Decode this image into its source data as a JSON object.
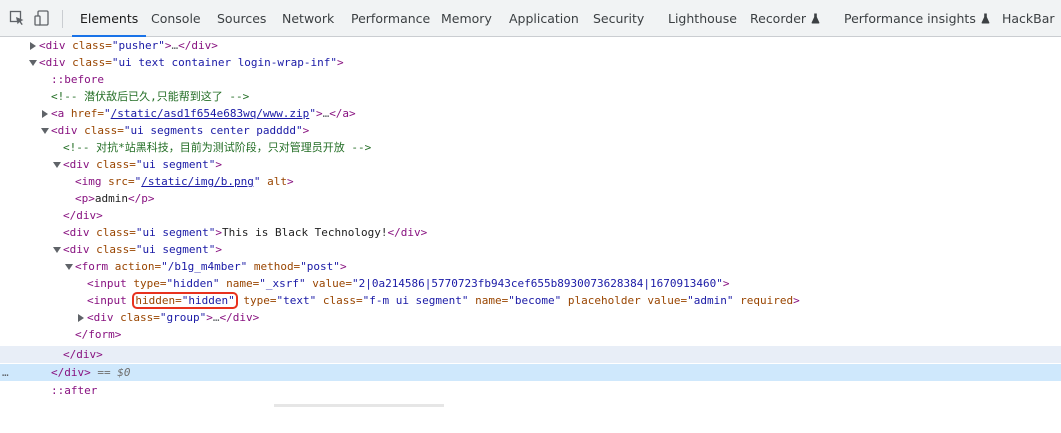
{
  "toolbar": {
    "inspect_icon": "select-element-icon",
    "device_icon": "device-toggle-icon",
    "tabs": [
      {
        "label": "Elements",
        "active": true
      },
      {
        "label": "Console"
      },
      {
        "label": "Sources"
      },
      {
        "label": "Network"
      },
      {
        "label": "Performance"
      },
      {
        "label": "Memory"
      },
      {
        "label": "Application"
      },
      {
        "label": "Security"
      },
      {
        "label": "Lighthouse"
      },
      {
        "label": "Recorder",
        "icon": "flask-icon"
      },
      {
        "label": "Performance insights",
        "icon": "flask-icon"
      },
      {
        "label": "HackBar"
      }
    ]
  },
  "tree": {
    "r0": {
      "open": "<div",
      "class_attr": " class=",
      "class_val": "\"pusher\"",
      "close": ">",
      "ellipsis": "…",
      "end": "</div>"
    },
    "r1": {
      "open": "<div",
      "class_attr": " class=",
      "class_val": "\"ui text container login-wrap-inf\"",
      "close": ">"
    },
    "r2": {
      "pseudo": "::before"
    },
    "r3": {
      "comment": "<!-- 潜伏敌后已久,只能帮到这了 -->"
    },
    "r4": {
      "open": "<a",
      "href_attr": " href=",
      "q1": "\"",
      "href_val": "/static/asd1f654e683wq/www.zip",
      "q2": "\"",
      "close": ">",
      "ellipsis": "…",
      "end": "</a>"
    },
    "r5": {
      "open": "<div",
      "class_attr": " class=",
      "class_val": "\"ui segments center padddd\"",
      "close": ">"
    },
    "r6": {
      "comment": "<!-- 对抗*站黑科技，目前为测试阶段，只对管理员开放 -->"
    },
    "r7": {
      "open": "<div",
      "class_attr": " class=",
      "class_val": "\"ui segment\"",
      "close": ">"
    },
    "r8": {
      "open": "<img",
      "src_attr": " src=",
      "q1": "\"",
      "src_val": "/static/img/b.png",
      "q2": "\"",
      "alt_attr": " alt",
      "close": ">"
    },
    "r9": {
      "open": "<p>",
      "text": "admin",
      "end": "</p>"
    },
    "r10": {
      "end": "</div>"
    },
    "r11": {
      "open": "<div",
      "class_attr": " class=",
      "class_val": "\"ui segment\"",
      "close": ">",
      "text": "This is Black Technology!",
      "end": "</div>"
    },
    "r12": {
      "open": "<div",
      "class_attr": " class=",
      "class_val": "\"ui segment\"",
      "close": ">"
    },
    "r13": {
      "open": "<form",
      "action_attr": " action=",
      "action_val": "\"/b1g_m4mber\"",
      "method_attr": " method=",
      "method_val": "\"post\"",
      "close": ">"
    },
    "r14": {
      "open": "<input",
      "type_attr": " type=",
      "type_val": "\"hidden\"",
      "name_attr": " name=",
      "name_val": "\"_xsrf\"",
      "value_attr": " value=",
      "value_val": "\"2|0a214586|5770723fb943cef655b8930073628384|1670913460\"",
      "close": ">"
    },
    "r15": {
      "open": "<input",
      "hidden_attr": "hidden=",
      "hidden_val": "\"hidden\"",
      "type_attr": " type=",
      "type_val": "\"text\"",
      "class_attr": " class=",
      "class_val": "\"f-m ui segment\"",
      "name_attr": " name=",
      "name_val": "\"become\"",
      "ph_attr": " placeholder",
      "value_attr": " value=",
      "value_val": "\"admin\"",
      "req_attr": " required",
      "close": ">"
    },
    "r16": {
      "open": "<div",
      "class_attr": " class=",
      "class_val": "\"group\"",
      "close": ">",
      "ellipsis": "…",
      "end": "</div>"
    },
    "r17": {
      "end": "</form>"
    },
    "r18": {
      "end": "</div>"
    },
    "r19": {
      "end": "</div>",
      "eq": " == $0",
      "gutter": "…"
    },
    "r20": {
      "pseudo": "::after"
    }
  }
}
